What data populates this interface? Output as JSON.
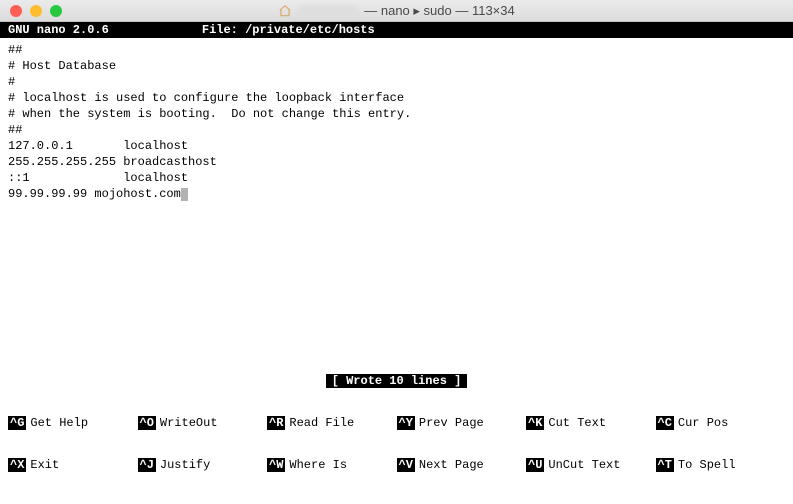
{
  "window": {
    "title_suffix": "— nano ▸ sudo — 113×34"
  },
  "nano": {
    "version": "GNU nano 2.0.6",
    "file_label": "File: /private/etc/hosts",
    "status": "[ Wrote 10 lines ]"
  },
  "file_lines": [
    "##",
    "# Host Database",
    "#",
    "# localhost is used to configure the loopback interface",
    "# when the system is booting.  Do not change this entry.",
    "##",
    "127.0.0.1       localhost",
    "255.255.255.255 broadcasthost",
    "::1             localhost",
    "99.99.99.99 mojohost.com"
  ],
  "shortcuts": {
    "row1": [
      {
        "key": "^G",
        "label": "Get Help"
      },
      {
        "key": "^O",
        "label": "WriteOut"
      },
      {
        "key": "^R",
        "label": "Read File"
      },
      {
        "key": "^Y",
        "label": "Prev Page"
      },
      {
        "key": "^K",
        "label": "Cut Text"
      },
      {
        "key": "^C",
        "label": "Cur Pos"
      }
    ],
    "row2": [
      {
        "key": "^X",
        "label": "Exit"
      },
      {
        "key": "^J",
        "label": "Justify"
      },
      {
        "key": "^W",
        "label": "Where Is"
      },
      {
        "key": "^V",
        "label": "Next Page"
      },
      {
        "key": "^U",
        "label": "UnCut Text"
      },
      {
        "key": "^T",
        "label": "To Spell"
      }
    ]
  }
}
